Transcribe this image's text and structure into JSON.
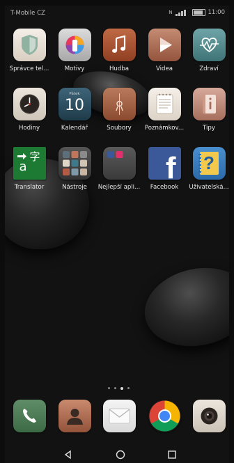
{
  "statusbar": {
    "carrier": "T-Mobile CZ",
    "time": "11:00"
  },
  "apps": [
    {
      "label": "Správce tel...",
      "icon": "shield-icon"
    },
    {
      "label": "Motivy",
      "icon": "brush-icon"
    },
    {
      "label": "Hudba",
      "icon": "music-note-icon"
    },
    {
      "label": "Videa",
      "icon": "play-icon"
    },
    {
      "label": "Zdraví",
      "icon": "heart-icon"
    },
    {
      "label": "Hodiny",
      "icon": "clock-icon"
    },
    {
      "label": "Kalendář",
      "icon": "calendar-icon",
      "day_name": "Pátek",
      "day_number": "10"
    },
    {
      "label": "Soubory",
      "icon": "folder-icon"
    },
    {
      "label": "Poznámkov...",
      "icon": "notepad-icon"
    },
    {
      "label": "Tipy",
      "icon": "info-icon"
    },
    {
      "label": "Translator",
      "icon": "translator-icon",
      "glyph_a": "a",
      "glyph_b": "字"
    },
    {
      "label": "Nástroje",
      "icon": "tools-folder-icon"
    },
    {
      "label": "Nejlepší apli...",
      "icon": "apps-folder-icon"
    },
    {
      "label": "Facebook",
      "icon": "facebook-icon",
      "glyph": "f"
    },
    {
      "label": "Uživatelská...",
      "icon": "user-manual-icon",
      "glyph": "?"
    }
  ],
  "dock": [
    {
      "name": "phone",
      "icon": "phone-icon"
    },
    {
      "name": "contacts",
      "icon": "contacts-icon"
    },
    {
      "name": "messages",
      "icon": "messages-icon"
    },
    {
      "name": "chrome",
      "icon": "chrome-icon"
    },
    {
      "name": "camera",
      "icon": "camera-icon"
    }
  ],
  "page_indicator": {
    "pages": 4,
    "current": 3
  },
  "navbar": [
    "back-icon",
    "home-icon",
    "recents-icon"
  ]
}
